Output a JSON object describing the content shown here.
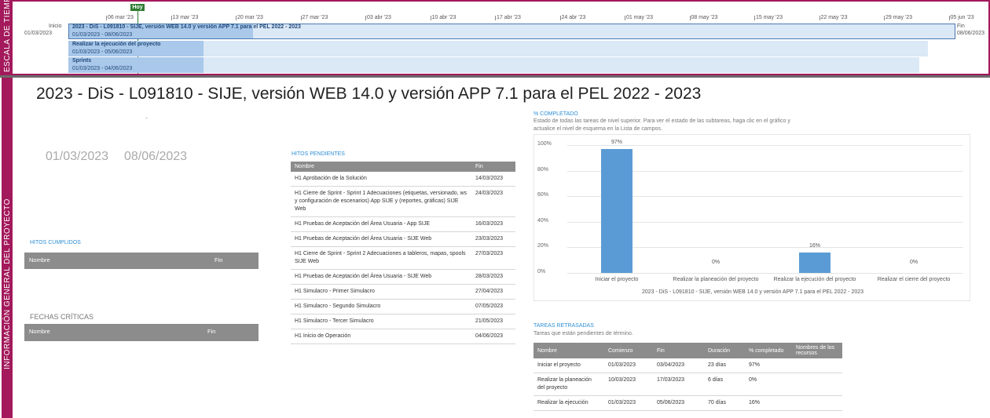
{
  "timeline": {
    "side_label": "ESCALA DE TIEMPO",
    "today_label": "Hoy",
    "start_label": "Inicio",
    "start_date": "01/03/2023",
    "end_label": "Fin",
    "end_date": "08/06/2023",
    "scale_dates": [
      "06 mar '23",
      "13 mar '23",
      "20 mar '23",
      "27 mar '23",
      "03 abr '23",
      "10 abr '23",
      "17 abr '23",
      "24 abr '23",
      "01 may '23",
      "08 may '23",
      "15 may '23",
      "22 may '23",
      "29 may '23",
      "05 jun '23"
    ],
    "bars": [
      {
        "title": "2023 - DiS - L091810 - SIJE, versión WEB 14.0 y versión APP 7.1 para el PEL 2022 - 2023",
        "dates": "01/03/2023 - 08/06/2023"
      },
      {
        "title": "Realizar la ejecución del proyecto",
        "dates": "01/03/2023 - 05/06/2023"
      },
      {
        "title": "Sprints",
        "dates": "01/03/2023 - 04/06/2023"
      }
    ]
  },
  "overview": {
    "side_label": "INFORMACIÓN GENERAL DEL PROYECTO",
    "title": "2023 - DiS - L091810 - SIJE, versión WEB 14.0 y versión APP 7.1 para el PEL 2022 - 2023",
    "dash": "-",
    "start_date": "01/03/2023",
    "end_date": "08/06/2023"
  },
  "hitos_cumplidos": {
    "title": "HITOS CUMPLIDOS",
    "col_name": "Nombre",
    "col_end": "Fin"
  },
  "fechas_criticas": {
    "title": "FECHAS CRÍTICAS",
    "col_name": "Nombre",
    "col_end": "Fin"
  },
  "hitos_pendientes": {
    "title": "HITOS PENDIENTES",
    "col_name": "Nombre",
    "col_end": "Fin",
    "rows": [
      {
        "name": "H1 Aprobación de la Solución",
        "end": "14/03/2023"
      },
      {
        "name": "H1 Cierre de Sprint - Sprint 1 Adecuaciones (etiquetas, versionado, ws y configuración de escenarios) App SIJE y (reportes, gráficas) SIJE Web",
        "end": "24/03/2023"
      },
      {
        "name": "H1 Pruebas de Aceptación del Área Usuaria - App SIJE",
        "end": "16/03/2023"
      },
      {
        "name": "H1 Pruebas de Aceptación del Área Usuaria - SIJE Web",
        "end": "23/03/2023"
      },
      {
        "name": "H1 Cierre de Sprint - Sprint 2 Adecuaciones a tableros, mapas, spools SIJE Web",
        "end": "27/03/2023"
      },
      {
        "name": "H1 Pruebas de Aceptación del Área Usuaria - SIJE Web",
        "end": "28/03/2023"
      },
      {
        "name": "H1 Simulacro - Primer Simulacro",
        "end": "27/04/2023"
      },
      {
        "name": "H1 Simulacro - Segundo Simulacro",
        "end": "07/05/2023"
      },
      {
        "name": "H1 Simulacro - Tercer Simulacro",
        "end": "21/05/2023"
      },
      {
        "name": "H1 Inicio de Operación",
        "end": "04/06/2023"
      }
    ]
  },
  "completion": {
    "title": "% COMPLETADO",
    "desc": "Estado de todas las tareas de nivel superior. Para ver el estado de las subtareas, haga clic en el gráfico y actualice el nivel de esquema en la Lista de campos."
  },
  "chart_data": {
    "type": "bar",
    "categories": [
      "Iniciar el proyecto",
      "Realizar la planeación del proyecto",
      "Realizar la ejecución del proyecto",
      "Realizar el cierre del proyecto"
    ],
    "values": [
      97,
      0,
      16,
      0
    ],
    "value_labels": [
      "97%",
      "0%",
      "16%",
      "0%"
    ],
    "yticks": [
      "0%",
      "20%",
      "40%",
      "60%",
      "80%",
      "100%"
    ],
    "ylim": [
      0,
      100
    ],
    "xlabel": "2023 - DiS - L091810 - SIJE, versión WEB 14.0 y versión APP 7.1 para el PEL 2022 - 2023",
    "ylabel": "",
    "color": "#5b9bd5",
    "grid": true
  },
  "tareas_retrasadas": {
    "title": "TAREAS RETRASADAS",
    "desc": "Tareas que están pendientes de término.",
    "headers": [
      "Nombre",
      "Comienzo",
      "Fin",
      "Duración",
      "% completado",
      "Nombres de los recursos"
    ],
    "rows": [
      {
        "name": "Iniciar el proyecto",
        "start": "01/03/2023",
        "end": "03/04/2023",
        "duration": "23 días",
        "pct": "97%",
        "resources": ""
      },
      {
        "name": "Realizar la planeación del proyecto",
        "start": "10/03/2023",
        "end": "17/03/2023",
        "duration": "6 días",
        "pct": "0%",
        "resources": ""
      },
      {
        "name": "Realizar la ejecución",
        "start": "01/03/2023",
        "end": "05/06/2023",
        "duration": "70 días",
        "pct": "16%",
        "resources": ""
      }
    ]
  }
}
